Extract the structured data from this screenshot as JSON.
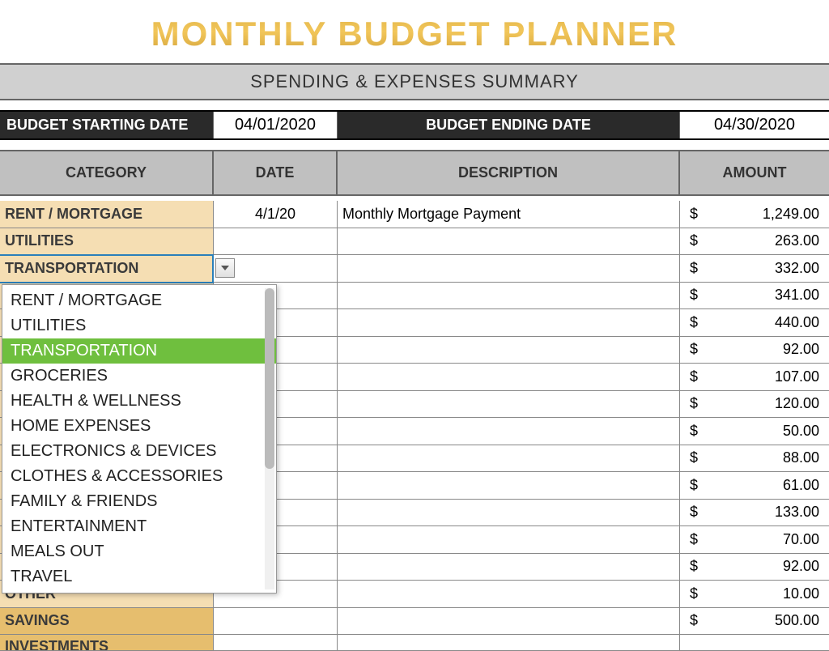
{
  "title": "MONTHLY BUDGET PLANNER",
  "subtitle": "SPENDING & EXPENSES SUMMARY",
  "dates": {
    "start_label": "BUDGET STARTING DATE",
    "start_value": "04/01/2020",
    "end_label": "BUDGET ENDING DATE",
    "end_value": "04/30/2020"
  },
  "headers": {
    "category": "CATEGORY",
    "date": "DATE",
    "description": "DESCRIPTION",
    "amount": "AMOUNT"
  },
  "rows": [
    {
      "category": "RENT / MORTGAGE",
      "date": "4/1/20",
      "description": "Monthly Mortgage Payment",
      "amount": "1,249.00"
    },
    {
      "category": "UTILITIES",
      "date": "",
      "description": "",
      "amount": "263.00"
    },
    {
      "category": "TRANSPORTATION",
      "date": "",
      "description": "",
      "amount": "332.00"
    },
    {
      "category": "",
      "date": "",
      "description": "",
      "amount": "341.00"
    },
    {
      "category": "",
      "date": "",
      "description": "",
      "amount": "440.00"
    },
    {
      "category": "",
      "date": "",
      "description": "",
      "amount": "92.00"
    },
    {
      "category": "",
      "date": "",
      "description": "",
      "amount": "107.00"
    },
    {
      "category": "",
      "date": "",
      "description": "",
      "amount": "120.00"
    },
    {
      "category": "",
      "date": "",
      "description": "",
      "amount": "50.00"
    },
    {
      "category": "",
      "date": "",
      "description": "",
      "amount": "88.00"
    },
    {
      "category": "",
      "date": "",
      "description": "",
      "amount": "61.00"
    },
    {
      "category": "",
      "date": "",
      "description": "",
      "amount": "133.00"
    },
    {
      "category": "",
      "date": "",
      "description": "",
      "amount": "70.00"
    },
    {
      "category": "",
      "date": "",
      "description": "",
      "amount": "92.00"
    },
    {
      "category": "OTHER",
      "date": "",
      "description": "",
      "amount": "10.00",
      "partial": true
    },
    {
      "category": "SAVINGS",
      "date": "",
      "description": "",
      "amount": "500.00",
      "savings": true
    },
    {
      "category": "INVESTMENTS",
      "date": "",
      "description": "",
      "amount": "",
      "investments": true,
      "cut": true
    }
  ],
  "dropdown": {
    "items": [
      "RENT / MORTGAGE",
      "UTILITIES",
      "TRANSPORTATION",
      "GROCERIES",
      "HEALTH & WELLNESS",
      "HOME EXPENSES",
      "ELECTRONICS & DEVICES",
      "CLOTHES & ACCESSORIES",
      "FAMILY & FRIENDS",
      "ENTERTAINMENT",
      "MEALS OUT",
      "TRAVEL"
    ],
    "highlighted_index": 2
  },
  "currency_symbol": "$"
}
